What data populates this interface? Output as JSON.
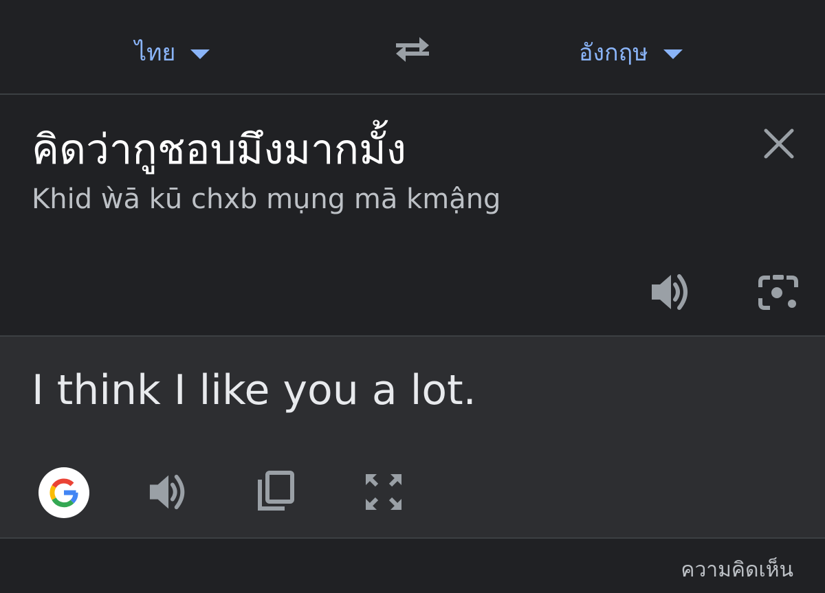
{
  "languages": {
    "source": "ไทย",
    "target": "อังกฤษ"
  },
  "icons": {
    "swap": "swap-arrows-icon",
    "close": "close-icon",
    "source_speaker": "speaker-icon",
    "camera": "camera-lens-icon",
    "google": "google-g-icon",
    "result_speaker": "speaker-icon",
    "copy": "copy-icon",
    "expand": "fullscreen-expand-icon"
  },
  "source": {
    "text": "คิดว่ากูชอบมึงมากมั้ง",
    "transliteration": "Khid ẁā kū chxb mụng mā kmậng"
  },
  "result": {
    "text": "I think I like you a lot."
  },
  "footer": {
    "feedback": "ความคิดเห็น"
  },
  "colors": {
    "background": "#202124",
    "result_background": "#2d2e31",
    "accent": "#8ab4f8",
    "icon": "#9aa0a6",
    "divider": "#3c4043"
  }
}
